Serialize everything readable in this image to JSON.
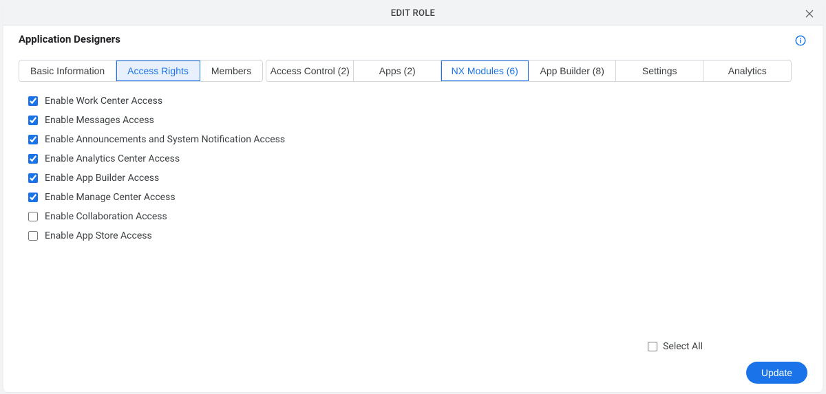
{
  "header": {
    "title": "EDIT ROLE"
  },
  "role": {
    "name": "Application Designers"
  },
  "main_tabs": [
    {
      "label": "Basic Information",
      "active": false
    },
    {
      "label": "Access Rights",
      "active": true
    },
    {
      "label": "Members",
      "active": false
    }
  ],
  "sub_tabs": [
    {
      "label": "Access Control (2)",
      "active": false
    },
    {
      "label": "Apps (2)",
      "active": false
    },
    {
      "label": "NX Modules (6)",
      "active": true
    },
    {
      "label": "App Builder (8)",
      "active": false
    },
    {
      "label": "Settings",
      "active": false
    },
    {
      "label": "Analytics",
      "active": false
    }
  ],
  "permissions": [
    {
      "label": "Enable Work Center Access",
      "checked": true
    },
    {
      "label": "Enable Messages Access",
      "checked": true
    },
    {
      "label": "Enable Announcements and System Notification Access",
      "checked": true
    },
    {
      "label": "Enable Analytics Center Access",
      "checked": true
    },
    {
      "label": "Enable App Builder Access",
      "checked": true
    },
    {
      "label": "Enable Manage Center Access",
      "checked": true
    },
    {
      "label": "Enable Collaboration Access",
      "checked": false
    },
    {
      "label": "Enable App Store Access",
      "checked": false
    }
  ],
  "footer": {
    "select_all_label": "Select All",
    "select_all_checked": false,
    "update_label": "Update"
  }
}
